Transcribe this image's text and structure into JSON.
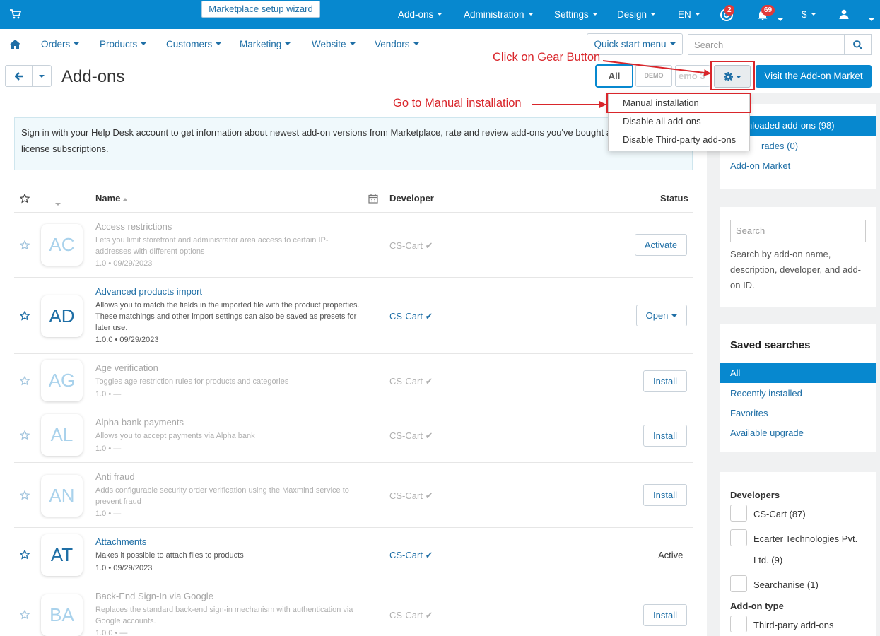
{
  "topbar": {
    "wizard": "Marketplace setup wizard",
    "menus": [
      "Add-ons",
      "Administration",
      "Settings",
      "Design",
      "EN"
    ],
    "badge_help": "2",
    "badge_notifications": "69",
    "currency": "$"
  },
  "nav": {
    "items": [
      "Orders",
      "Products",
      "Customers",
      "Marketing",
      "Website",
      "Vendors"
    ],
    "quick_start": "Quick start menu",
    "search_placeholder": "Search"
  },
  "header": {
    "title": "Add-ons",
    "tab_all": "All",
    "tab_demo": "DEMO",
    "tab_demo3": "emo 3",
    "visit_market": "Visit the Add-on Market"
  },
  "dropdown": {
    "items": [
      "Manual installation",
      "Disable all add-ons",
      "Disable Third-party add-ons"
    ]
  },
  "annotations": {
    "gear": "Click on Gear Button",
    "manual": "Go to Manual installation"
  },
  "info_banner": "Sign in with your Help Desk account to get information about newest add-on versions from Marketplace, rate and review add-ons you've bought and prolong your license subscriptions.",
  "table": {
    "headers": {
      "name": "Name",
      "developer": "Developer",
      "status": "Status"
    },
    "rows": [
      {
        "logo": "AC",
        "name": "Access restrictions",
        "desc": "Lets you limit storefront and administrator area access to certain IP-addresses with different options",
        "version": "1.0 • 09/29/2023",
        "developer": "CS-Cart",
        "action": "Activate",
        "state": "disabled"
      },
      {
        "logo": "AD",
        "name": "Advanced products import",
        "desc": "Allows you to match the fields in the imported file with the product properties. These matchings and other import settings can also be saved as presets for later use.",
        "version": "1.0.0 • 09/29/2023",
        "developer": "CS-Cart",
        "action": "Open",
        "state": "enabled"
      },
      {
        "logo": "AG",
        "name": "Age verification",
        "desc": "Toggles age restriction rules for products and categories",
        "version": "1.0 • —",
        "developer": "CS-Cart",
        "action": "Install",
        "state": "disabled"
      },
      {
        "logo": "AL",
        "name": "Alpha bank payments",
        "desc": "Allows you to accept payments via Alpha bank",
        "version": "1.0 • —",
        "developer": "CS-Cart",
        "action": "Install",
        "state": "disabled"
      },
      {
        "logo": "AN",
        "name": "Anti fraud",
        "desc": "Adds configurable security order verification using the Maxmind service to prevent fraud",
        "version": "1.0 • —",
        "developer": "CS-Cart",
        "action": "Install",
        "state": "disabled"
      },
      {
        "logo": "AT",
        "name": "Attachments",
        "desc": "Makes it possible to attach files to products",
        "version": "1.0 • 09/29/2023",
        "developer": "CS-Cart",
        "action": "Active",
        "state": "enabled"
      },
      {
        "logo": "BA",
        "name": "Back-End Sign-In via Google",
        "desc": "Replaces the standard back-end sign-in mechanism with authentication via Google accounts.",
        "version": "1.0.0 • —",
        "developer": "CS-Cart",
        "action": "Install",
        "state": "disabled"
      }
    ]
  },
  "sidebar": {
    "downloaded": "nloaded add-ons (98)",
    "upgrades": "rades (0)",
    "market": "Add-on Market",
    "search_placeholder": "Search",
    "search_help": "Search by add-on name, description, developer, and add-on ID.",
    "saved_title": "Saved searches",
    "saved": [
      "All",
      "Recently installed",
      "Favorites",
      "Available upgrade"
    ],
    "developers_title": "Developers",
    "developers": [
      "CS-Cart (87)",
      "Ecarter Technologies Pvt.",
      "Ltd. (9)",
      "Searchanise (1)"
    ],
    "addon_type_title": "Add-on type",
    "addon_types": [
      "Third-party add-ons"
    ]
  },
  "colors": {
    "primary": "#0788cf",
    "annotation": "#d9262b",
    "link": "#1f6fa6"
  }
}
